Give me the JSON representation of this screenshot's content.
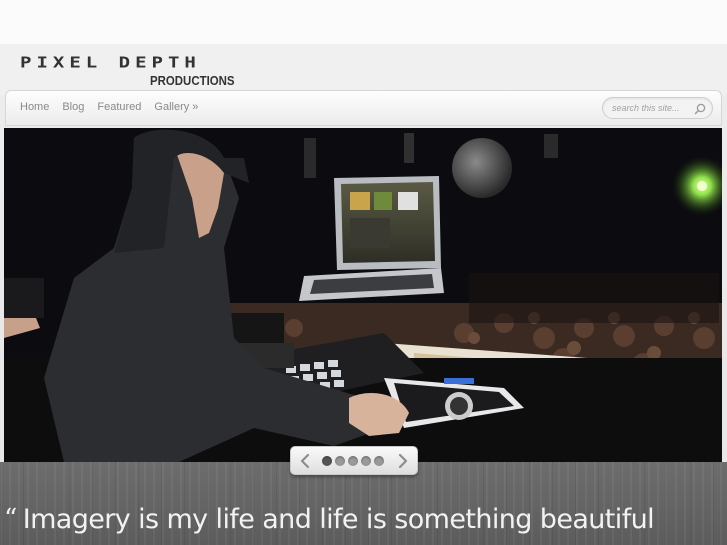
{
  "header": {
    "logo_main": "PIXEL DEPTH",
    "logo_sub": "PRODUCTIONS"
  },
  "nav": {
    "items": [
      {
        "label": "Home"
      },
      {
        "label": "Blog"
      },
      {
        "label": "Featured"
      },
      {
        "label": "Gallery »"
      }
    ]
  },
  "search": {
    "placeholder": "search this site...",
    "icon": "search-icon"
  },
  "slider": {
    "image_alt": "DJ performing in front of a crowd",
    "slide_count": 5,
    "active_slide": 1,
    "prev_icon": "chevron-left-icon",
    "next_icon": "chevron-right-icon"
  },
  "tagline": {
    "quote_mark": "“",
    "text": "Imagery is my life and life is something beautiful"
  },
  "colors": {
    "nav_text": "#8a8a8a",
    "logo_text": "#333333",
    "wood_background": "#636363",
    "quote_text": "#f2f2f2"
  }
}
